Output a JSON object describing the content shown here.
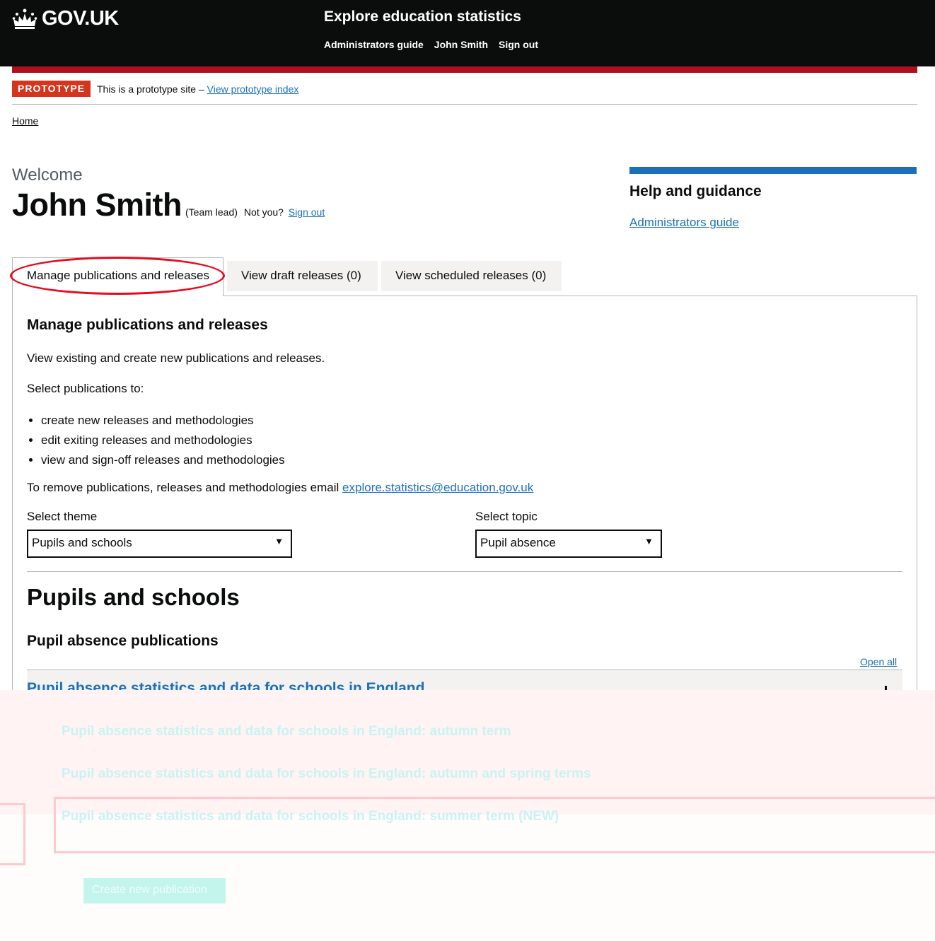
{
  "header": {
    "logo_text": "GOV.UK",
    "logo_icon": "crown-icon",
    "service_name": "Explore education statistics",
    "nav": [
      "Administrators guide",
      "John Smith",
      "Sign out"
    ]
  },
  "phase_banner": {
    "tag": "PROTOTYPE",
    "text": "This is a prototype site –",
    "link": "View prototype index"
  },
  "breadcrumb": {
    "home": "Home"
  },
  "welcome": {
    "label": "Welcome",
    "name": "John Smith",
    "role": "(Team lead)",
    "not_you": "Not you?",
    "sign_out": "Sign out"
  },
  "help": {
    "title": "Help and guidance",
    "link": "Administrators guide"
  },
  "tabs": [
    {
      "label": "Manage publications and releases",
      "active": true
    },
    {
      "label": "View draft releases (0)",
      "active": false
    },
    {
      "label": "View scheduled releases (0)",
      "active": false
    }
  ],
  "panel": {
    "title": "Manage publications and releases",
    "intro": "View existing and create new publications and releases.",
    "select_intro": "Select publications to:",
    "bullets": [
      "create new releases and methodologies",
      "edit exiting releases and methodologies",
      "view and sign-off releases and methodologies"
    ],
    "remove_text": "To remove publications, releases and methodologies email",
    "email": "explore.statistics@education.gov.uk",
    "theme_label": "Select theme",
    "theme_value": "Pupils and schools",
    "topic_label": "Select topic",
    "topic_value": "Pupil absence",
    "theme_heading": "Pupils and schools",
    "topic_heading": "Pupil absence publications",
    "open_all": "Open all",
    "accordion_title": "Pupil absence statistics and data for schools in England"
  },
  "faded": {
    "links": [
      "Pupil absence statistics and data for schools in England: autumn term",
      "Pupil absence statistics and data for schools in England: autumn and spring terms",
      "Pupil absence statistics and data for schools in England: summer term (NEW)"
    ],
    "button": "Create new publication"
  },
  "colors": {
    "header_bg": "#0b0c0c",
    "red_bar": "#b10e1e",
    "phase_tag": "#d4351c",
    "link": "#1d70b8",
    "annotation_circle": "#e8091d"
  }
}
